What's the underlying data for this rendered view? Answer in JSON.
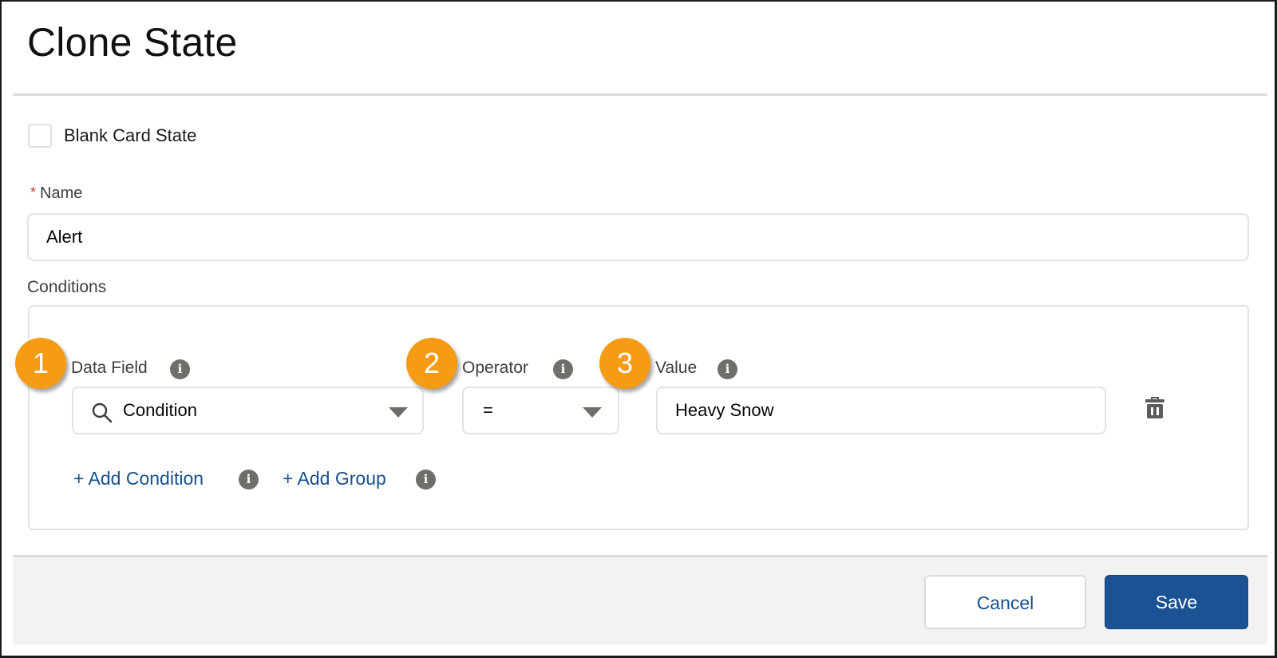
{
  "modal": {
    "title": "Clone State"
  },
  "blank_card_state": {
    "label": "Blank Card State",
    "checked": false
  },
  "name_field": {
    "required_marker": "*",
    "label": "Name",
    "value": "Alert"
  },
  "conditions": {
    "label": "Conditions",
    "row": {
      "data_field": {
        "badge": "1",
        "label": "Data Field",
        "info_icon": "info-icon",
        "value": "Condition",
        "icon": "search-icon"
      },
      "operator": {
        "badge": "2",
        "label": "Operator",
        "info_icon": "info-icon",
        "value": "="
      },
      "value": {
        "badge": "3",
        "label": "Value",
        "info_icon": "info-icon",
        "value": "Heavy Snow"
      },
      "delete_icon": "trash-icon"
    },
    "add_condition_label": "+ Add Condition",
    "add_group_label": "+ Add Group"
  },
  "footer": {
    "cancel_label": "Cancel",
    "save_label": "Save"
  },
  "colors": {
    "badge": "#f59b14",
    "link": "#16508f",
    "primary_button": "#1a5294",
    "required": "#c23934"
  }
}
